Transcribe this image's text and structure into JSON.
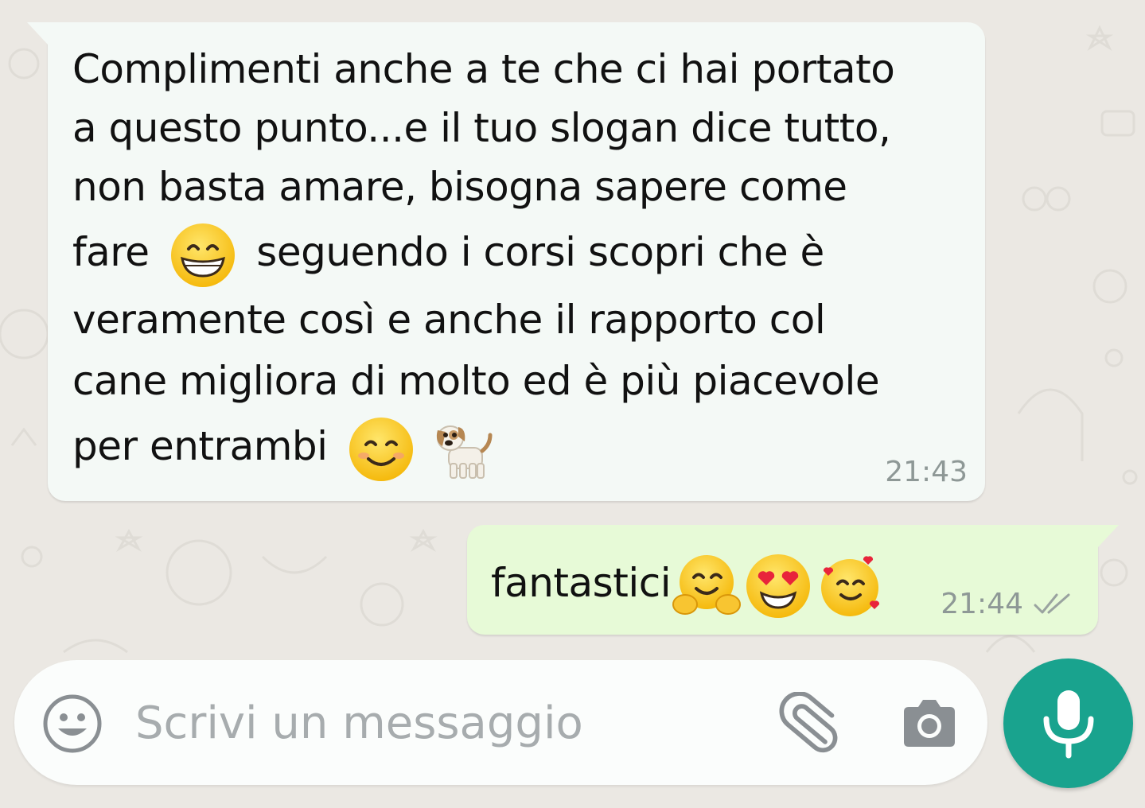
{
  "chat": {
    "incoming": {
      "lines": [
        "Complimenti anche a te che ci hai portato",
        "a questo punto...e il tuo slogan dice tutto,",
        "non basta amare, bisogna sapere come",
        "fare",
        "seguendo i corsi scopri che è",
        "veramente così e anche il rapporto col",
        "cane migliora di molto ed è più piacevole",
        "per entrambi"
      ],
      "time": "21:43",
      "emojis": [
        "grinning-face-icon",
        "smiling-face-icon",
        "dog-icon"
      ]
    },
    "outgoing": {
      "text": "fantastici",
      "time": "21:44",
      "status": "delivered-double-check",
      "emojis": [
        "hugging-face-icon",
        "heart-eyes-face-icon",
        "smiling-face-with-hearts-icon"
      ]
    }
  },
  "composer": {
    "placeholder": "Scrivi un messaggio",
    "icons": [
      "emoji-icon",
      "attach-icon",
      "camera-icon",
      "mic-icon"
    ]
  },
  "colors": {
    "background": "#ebe8e3",
    "incoming_bubble": "#f4f9f6",
    "outgoing_bubble": "#e7fad7",
    "accent": "#19a38e",
    "timestamp": "#8e9896"
  }
}
